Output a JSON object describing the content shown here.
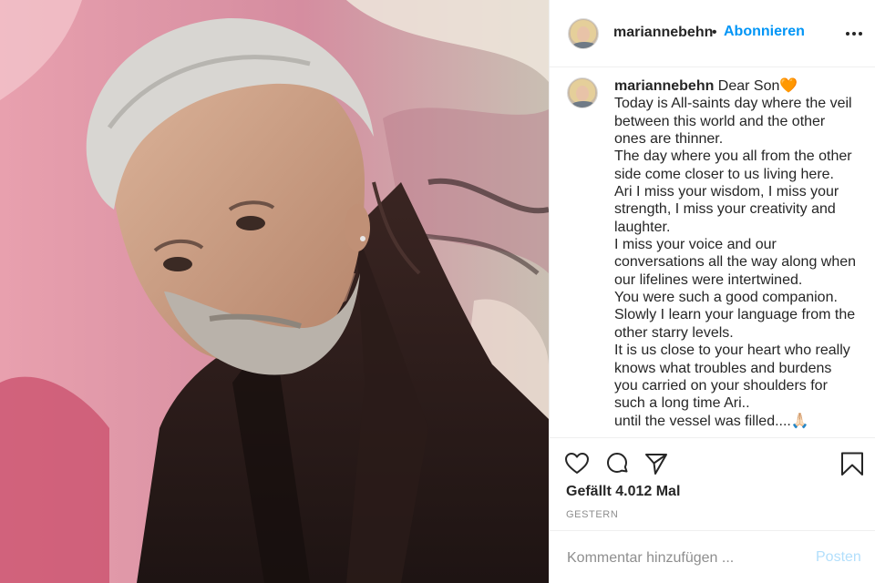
{
  "post": {
    "username": "mariannebehn",
    "dot": "•",
    "follow_label": "Abonnieren",
    "caption": {
      "username": "mariannebehn",
      "first_line_text": " Dear Son🧡",
      "lines": [
        "Today is All-saints day where the veil",
        "between this world and the other",
        "ones are thinner.",
        "The day where you all from the other",
        "side come closer to us living here.",
        "Ari I miss your wisdom, I miss your",
        "strength, I miss your creativity and",
        "laughter.",
        "I miss your voice and our",
        "conversations all the way along when",
        "our lifelines were intertwined.",
        "You were such a good companion.",
        "Slowly I learn your language from the",
        "other starry levels.",
        "It is us close to your heart who really",
        "knows what troubles and burdens",
        "you carried on your shoulders for",
        "such a long time Ari..",
        "until the vessel was filled....🙏🏻"
      ]
    },
    "likes_text": "Gefällt 4.012 Mal",
    "time_text": "GESTERN",
    "comment_placeholder": "Kommentar hinzufügen ...",
    "post_label": "Posten"
  },
  "icons": {
    "more": "more-options-icon",
    "like": "heart-icon",
    "comment": "comment-icon",
    "share": "paper-plane-icon",
    "save": "bookmark-icon"
  },
  "colors": {
    "accent": "#0095f6",
    "post_disabled": "#b2dffc",
    "text": "#262626",
    "muted": "#8e8e8e",
    "divider": "#efefef"
  }
}
